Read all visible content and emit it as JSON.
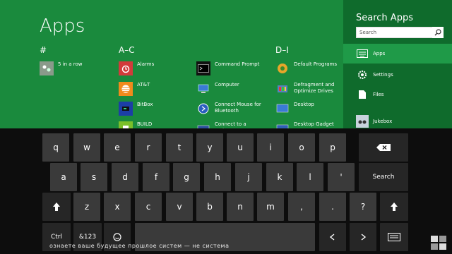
{
  "start": {
    "title": "Apps",
    "groups": [
      "#",
      "A–C",
      "D–I"
    ]
  },
  "apps": {
    "five_in_a_row": "5 in a row",
    "alarms": "Alarms",
    "att": "AT&T",
    "bitbox": "BitBox",
    "build": "BUILD",
    "command_prompt": "Command Prompt",
    "computer": "Computer",
    "connect_mouse": "Connect Mouse for Bluetooth",
    "connect_projector": "Connect to a Projector",
    "default_programs": "Default Programs",
    "defragment": "Defragment and Optimize Drives",
    "desktop": "Desktop",
    "desktop_gadget": "Desktop Gadget"
  },
  "charm": {
    "title": "Search Apps",
    "search_value": "Search",
    "items": [
      "Apps",
      "Settings",
      "Files",
      "Jukebox"
    ]
  },
  "keyboard": {
    "row1": [
      "q",
      "w",
      "e",
      "r",
      "t",
      "y",
      "u",
      "i",
      "o",
      "p"
    ],
    "row2": [
      "a",
      "s",
      "d",
      "f",
      "g",
      "h",
      "j",
      "k",
      "l",
      "'"
    ],
    "row2_action": "Search",
    "row3": [
      "z",
      "x",
      "c",
      "v",
      "b",
      "n",
      "m",
      ",",
      ".",
      "?"
    ],
    "ctrl": "Ctrl",
    "numsym": "&123"
  },
  "watermark": "ознаете ваше будущее прошлое систем — не система"
}
